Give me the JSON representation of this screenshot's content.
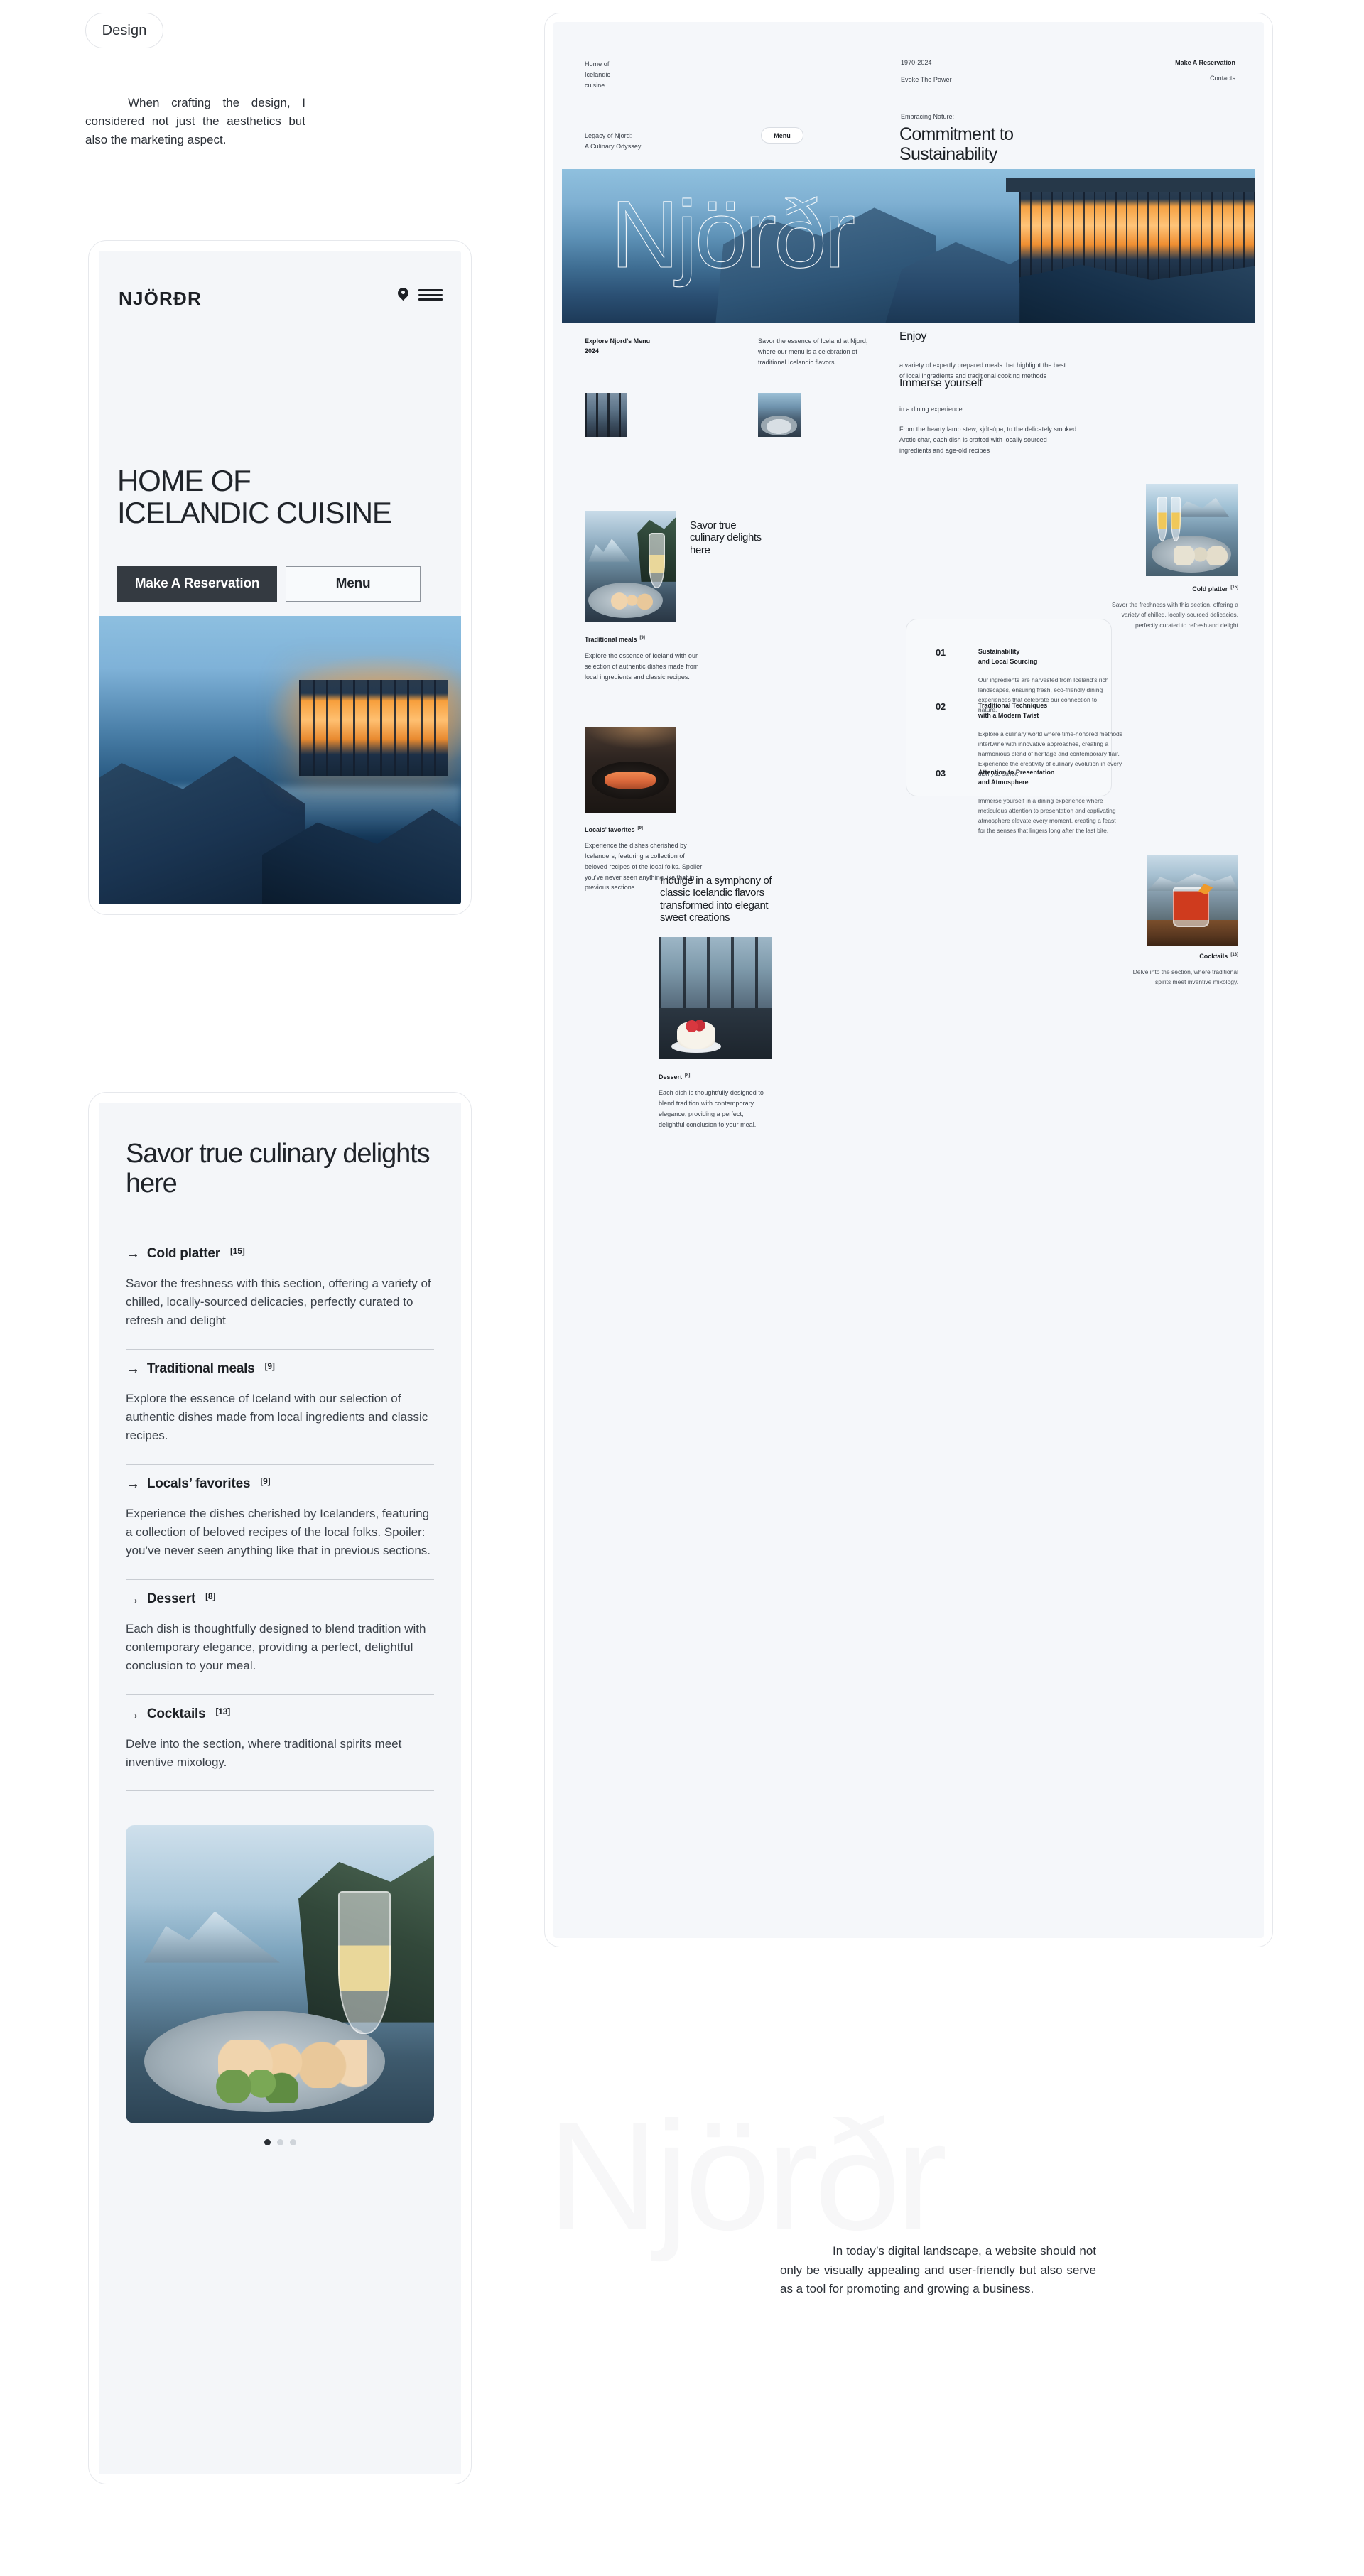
{
  "badge": {
    "label": "Design"
  },
  "intro": {
    "text": "When crafting the design, I considered not just the aesthetics but also the marketing aspect."
  },
  "mobile_hero": {
    "brand": "NJÖRÐR",
    "icons": {
      "location": "location-pin-icon",
      "menu": "hamburger-menu-icon"
    },
    "headline_line1": "HOME OF",
    "headline_line2": "ICELANDIC CUISINE",
    "primary_button": "Make A Reservation",
    "secondary_button": "Menu"
  },
  "mobile_menu": {
    "title": "Savor true culinary delights here",
    "items": [
      {
        "label": "Cold platter",
        "count": "[15]",
        "text": "Savor the freshness with this section, offering a variety of chilled, locally-sourced delicacies, perfectly curated to refresh and delight"
      },
      {
        "label": "Traditional meals",
        "count": "[9]",
        "text": "Explore the essence of Iceland with our selection of authentic dishes made from local ingredients and classic recipes."
      },
      {
        "label": "Locals’ favorites",
        "count": "[9]",
        "text": "Experience the dishes cherished by Icelanders, featuring a collection of beloved recipes of the local folks. Spoiler: you’ve never seen anything like that in previous sections."
      },
      {
        "label": "Dessert",
        "count": "[8]",
        "text": "Each dish is thoughtfully designed to blend tradition with contemporary elegance, providing a perfect, delightful conclusion to your meal."
      },
      {
        "label": "Cocktails",
        "count": "[13]",
        "text": "Delve into the section, where traditional spirits meet inventive mixology."
      }
    ],
    "carousel_dots": 3,
    "active_dot": 1
  },
  "desktop": {
    "nav": {
      "left": "Home of\nIcelandic\ncuisine",
      "mid_line1": "1970-2024",
      "mid_line2": "Evoke The Power",
      "right_line1": "Make A Reservation",
      "right_line2": "Contacts",
      "legacy": "Legacy of Njord:\nA Culinary Odyssey",
      "menu_pill": "Menu"
    },
    "hero": {
      "eyebrow": "Embracing Nature:",
      "title_line1": "Commitment to",
      "title_line2": "Sustainability",
      "outline_word": "Njörðr"
    },
    "menu_block": {
      "col1_line1": "Explore Njord’s Menu",
      "col1_line2": "2024",
      "col2": "Savor the essence of Iceland at Njord, where our menu is a celebration of traditional Icelandic flavors",
      "enjoy_title": "Enjoy",
      "enjoy_text": "a variety of expertly prepared meals that highlight the best of local ingredients and traditional cooking methods",
      "immerse_title": "Immerse yourself",
      "immerse_sub": "in a dining experience",
      "immerse_text": "From the hearty lamb stew, kjötsúpa, to the delicately smoked Arctic char, each dish is crafted with locally sourced ingredients and age-old recipes"
    },
    "savor": {
      "title_line1": "Savor true",
      "title_line2": "culinary delights",
      "title_line3": "here",
      "cold_platter_title": "Cold platter",
      "cold_platter_count": "[15]",
      "cold_platter_text": "Savor the freshness with this section, offering a variety of chilled, locally-sourced delicacies, perfectly curated to refresh and delight",
      "traditional_title": "Traditional meals",
      "traditional_count": "[9]",
      "traditional_text": "Explore the essence of Iceland with our selection of authentic dishes made from local ingredients and classic recipes.",
      "locals_title": "Locals’ favorites",
      "locals_count": "[9]",
      "locals_text": "Experience the dishes cherished by Icelanders, featuring a collection of beloved recipes of the local folks. Spoiler: you’ve never seen anything like that in previous sections."
    },
    "steps": [
      {
        "num": "01",
        "title": "Sustainability\nand Local Sourcing",
        "text": "Our ingredients are harvested from Iceland’s rich landscapes, ensuring fresh, eco-friendly dining experiences that celebrate our connection to nature."
      },
      {
        "num": "02",
        "title": "Traditional Techniques\nwith a Modern Twist",
        "text": "Explore a culinary world where time-honored methods intertwine with innovative approaches, creating a harmonious blend of heritage and contemporary flair. Experience the creativity of culinary evolution in every dish you savor."
      },
      {
        "num": "03",
        "title": "Attention to Presentation\nand Atmosphere",
        "text": "Immerse yourself in a dining experience where meticulous attention to presentation and captivating atmosphere elevate every moment, creating a feast for the senses that lingers long after the last bite."
      }
    ],
    "indulge": {
      "title_line1": "Indulge in a symphony of",
      "title_line2": "classic Icelandic flavors",
      "title_line3": "transformed into elegant",
      "title_line4": "sweet creations",
      "cocktails_title": "Cocktails",
      "cocktails_count": "[13]",
      "cocktails_text": "Delve into the section, where traditional spirits meet inventive mixology.",
      "dessert_title": "Dessert",
      "dessert_count": "[8]",
      "dessert_text": "Each dish is thoughtfully designed to blend tradition with contemporary elegance, providing a perfect, delightful conclusion to your meal."
    }
  },
  "footer": {
    "watermark": "Njörðr",
    "text": "In today’s digital landscape, a website should not only be visually appealing and user-friendly but also serve as a tool for promoting and growing a business."
  }
}
